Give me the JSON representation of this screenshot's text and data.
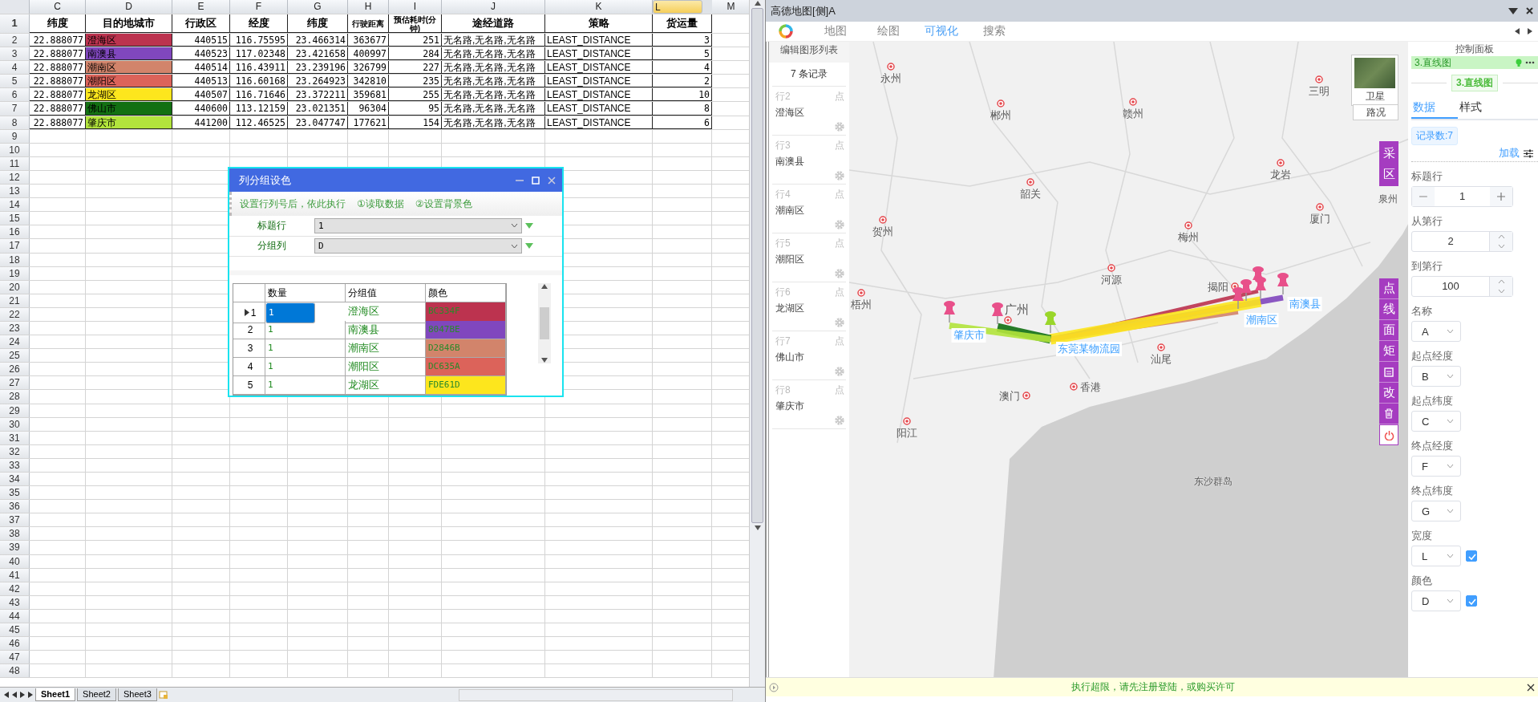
{
  "spreadsheet": {
    "column_headers": [
      {
        "label": "C",
        "selected": false
      },
      {
        "label": "D",
        "selected": false
      },
      {
        "label": "E",
        "selected": false
      },
      {
        "label": "F",
        "selected": false
      },
      {
        "label": "G",
        "selected": false
      },
      {
        "label": "H",
        "selected": false
      },
      {
        "label": "I",
        "selected": false
      },
      {
        "label": "J",
        "selected": false
      },
      {
        "label": "K",
        "selected": false
      },
      {
        "label": "L",
        "selected": true
      },
      {
        "label": "M",
        "selected": false
      }
    ],
    "header_row": {
      "number": "1",
      "cells": [
        "纬度",
        "目的地城市",
        "行政区",
        "经度",
        "纬度",
        "行驶距离",
        "预估耗时(分钟)",
        "途经道路",
        "策略",
        "货运量"
      ]
    },
    "rows": [
      {
        "number": "2",
        "color": "#bc334f",
        "cells": [
          "22.888077",
          "澄海区",
          "440515",
          "116.75595",
          "23.466314",
          "363677",
          "251",
          "无名路,无名路,无名路",
          "LEAST_DISTANCE",
          "3"
        ]
      },
      {
        "number": "3",
        "color": "#8047be",
        "cells": [
          "22.888077",
          "南澳县",
          "440523",
          "117.02348",
          "23.421658",
          "400997",
          "284",
          "无名路,无名路,无名路",
          "LEAST_DISTANCE",
          "5"
        ]
      },
      {
        "number": "4",
        "color": "#d2846b",
        "cells": [
          "22.888077",
          "潮南区",
          "440514",
          "116.43911",
          "23.239196",
          "326799",
          "227",
          "无名路,无名路,无名路",
          "LEAST_DISTANCE",
          "4"
        ]
      },
      {
        "number": "5",
        "color": "#dc635a",
        "cells": [
          "22.888077",
          "潮阳区",
          "440513",
          "116.60168",
          "23.264923",
          "342810",
          "235",
          "无名路,无名路,无名路",
          "LEAST_DISTANCE",
          "2"
        ]
      },
      {
        "number": "6",
        "color": "#fde61d",
        "cells": [
          "22.888077",
          "龙湖区",
          "440507",
          "116.71646",
          "23.372211",
          "359681",
          "255",
          "无名路,无名路,无名路",
          "LEAST_DISTANCE",
          "10"
        ]
      },
      {
        "number": "7",
        "color": "#127012",
        "cells": [
          "22.888077",
          "佛山市",
          "440600",
          "113.12159",
          "23.021351",
          "96304",
          "95",
          "无名路,无名路,无名路",
          "LEAST_DISTANCE",
          "8"
        ]
      },
      {
        "number": "8",
        "color": "#b2e43c",
        "cells": [
          "22.888077",
          "肇庆市",
          "441200",
          "112.46525",
          "23.047747",
          "177621",
          "154",
          "无名路,无名路,无名路",
          "LEAST_DISTANCE",
          "6"
        ]
      }
    ],
    "empty_rows": [
      "9",
      "10",
      "11",
      "12",
      "13",
      "14",
      "15",
      "16",
      "17",
      "18",
      "19",
      "20",
      "21",
      "22",
      "23",
      "24",
      "25",
      "26",
      "27",
      "28",
      "29",
      "30",
      "31",
      "32",
      "33",
      "34",
      "35",
      "36",
      "37",
      "38",
      "39",
      "40",
      "41",
      "42",
      "43",
      "44",
      "45",
      "46",
      "47",
      "48"
    ],
    "sheet_tabs": [
      {
        "label": "Sheet1",
        "selected": true
      },
      {
        "label": "Sheet2",
        "selected": false
      },
      {
        "label": "Sheet3",
        "selected": false
      }
    ]
  },
  "dialog": {
    "title": "列分组设色",
    "toolbar_text": "设置行列号后，依此执行",
    "toolbar_buttons": [
      "①读取数据",
      "②设置背景色"
    ],
    "fields": [
      {
        "label": "标题行",
        "value": "1"
      },
      {
        "label": "分组列",
        "value": "D"
      }
    ],
    "grid": {
      "columns": [
        "数量",
        "分组值",
        "颜色"
      ],
      "rows": [
        {
          "number": "1",
          "quantity": "1",
          "group": "澄海区",
          "color_text": "BC334F",
          "color": "#bc334f",
          "selected": true
        },
        {
          "number": "2",
          "quantity": "1",
          "group": "南澳县",
          "color_text": "8047BE",
          "color": "#8047be",
          "selected": false
        },
        {
          "number": "3",
          "quantity": "1",
          "group": "潮南区",
          "color_text": "D2846B",
          "color": "#d2846b",
          "selected": false
        },
        {
          "number": "4",
          "quantity": "1",
          "group": "潮阳区",
          "color_text": "DC635A",
          "color": "#dc635a",
          "selected": false
        },
        {
          "number": "5",
          "quantity": "1",
          "group": "龙湖区",
          "color_text": "FDE61D",
          "color": "#fde61d",
          "selected": false
        }
      ]
    }
  },
  "map_window": {
    "title": "高德地图[侧]A",
    "nav_tabs": [
      {
        "label": "地图",
        "selected": false
      },
      {
        "label": "绘图",
        "selected": false
      },
      {
        "label": "可视化",
        "selected": true
      },
      {
        "label": "搜索",
        "selected": false
      }
    ],
    "shape_list": {
      "title": "编辑图形列表",
      "count": "7 条记录",
      "items": [
        {
          "row": "行2",
          "type": "点",
          "name": "澄海区"
        },
        {
          "row": "行3",
          "type": "点",
          "name": "南澳县"
        },
        {
          "row": "行4",
          "type": "点",
          "name": "潮南区"
        },
        {
          "row": "行5",
          "type": "点",
          "name": "潮阳区"
        },
        {
          "row": "行6",
          "type": "点",
          "name": "龙湖区"
        },
        {
          "row": "行7",
          "type": "点",
          "name": "佛山市"
        },
        {
          "row": "行8",
          "type": "点",
          "name": "肇庆市"
        }
      ]
    },
    "map": {
      "cities": [
        "永州",
        "三明",
        "郴州",
        "赣州",
        "韶关",
        "龙岩",
        "贺州",
        "厦门",
        "梅州",
        "泉州",
        "河源",
        "揭阳",
        "梧州",
        "广州",
        "汕尾",
        "香港",
        "澳门",
        "阳江",
        "东沙群岛"
      ],
      "route_labels": [
        "肇庆市",
        "东莞某物流园",
        "潮南区",
        "南澳县"
      ],
      "satellite_label": "卫星",
      "traffic_button": "路况",
      "capture_tool": "采区",
      "draw_tools": [
        "点",
        "线",
        "面",
        "矩"
      ],
      "edit_tool": "改"
    },
    "control_panel": {
      "title": "控制面板",
      "layer": "3.直线图",
      "section_badge": "3.直线图",
      "tabs": [
        {
          "label": "数据",
          "selected": true
        },
        {
          "label": "样式",
          "selected": false
        }
      ],
      "record_count": "记录数:7",
      "load_link": "加载",
      "fields": [
        {
          "kind": "stepper",
          "label": "标题行",
          "value": "1"
        },
        {
          "kind": "spinner",
          "label": "从第行",
          "value": "2"
        },
        {
          "kind": "spinner",
          "label": "到第行",
          "value": "100"
        },
        {
          "kind": "select",
          "label": "名称",
          "value": "A"
        },
        {
          "kind": "select",
          "label": "起点经度",
          "value": "B"
        },
        {
          "kind": "select",
          "label": "起点纬度",
          "value": "C"
        },
        {
          "kind": "select",
          "label": "终点经度",
          "value": "F"
        },
        {
          "kind": "select",
          "label": "终点纬度",
          "value": "G"
        },
        {
          "kind": "toggle_select",
          "label": "宽度",
          "value": "L",
          "checked": true
        },
        {
          "kind": "toggle_select",
          "label": "颜色",
          "value": "D",
          "checked": true
        }
      ]
    },
    "status_bar": "执行超限，请先注册登陆，或购买许可"
  }
}
